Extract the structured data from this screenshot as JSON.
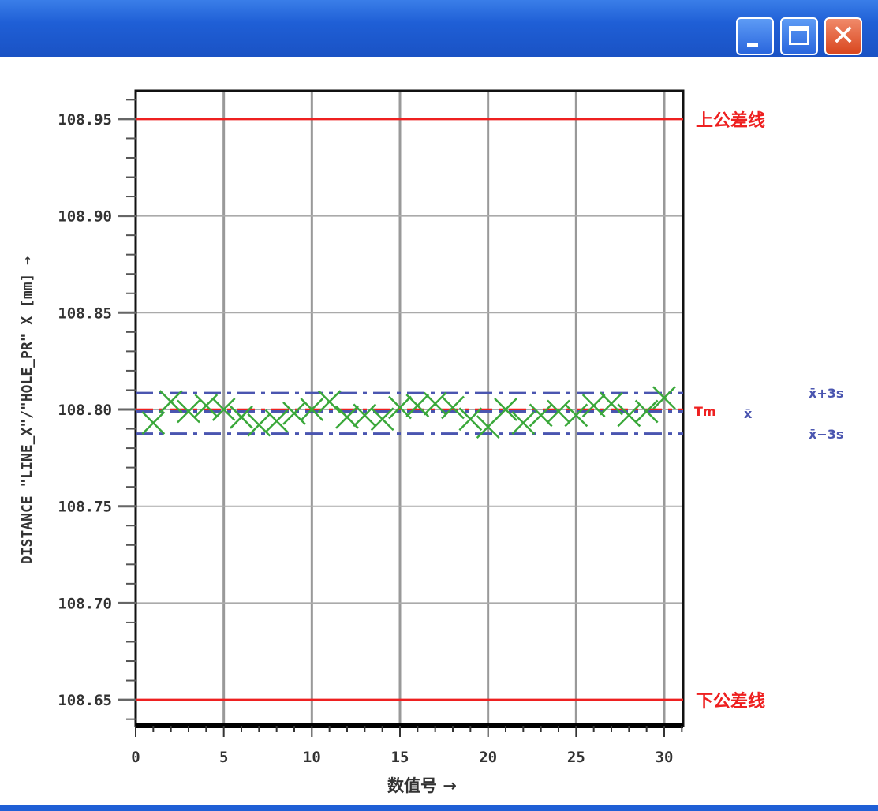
{
  "window": {
    "buttons": [
      "minimize",
      "maximize",
      "close"
    ]
  },
  "chart_data": {
    "type": "scatter",
    "xlabel": "数值号 →",
    "ylabel": "DISTANCE \"LINE_X\"/\"HOLE_PR\" X [mm] →",
    "xlim": [
      0,
      31
    ],
    "ylim": [
      108.636,
      108.964
    ],
    "xticks": [
      0,
      5,
      10,
      15,
      20,
      25,
      30
    ],
    "yticks": [
      108.65,
      108.7,
      108.75,
      108.8,
      108.85,
      108.9,
      108.95
    ],
    "ytick_labels": [
      "108.65",
      "108.70",
      "108.75",
      "108.80",
      "108.85",
      "108.90",
      "108.95"
    ],
    "grid": true,
    "x": [
      1,
      2,
      3,
      4,
      5,
      6,
      7,
      8,
      9,
      10,
      11,
      12,
      13,
      14,
      15,
      16,
      17,
      18,
      19,
      20,
      21,
      22,
      23,
      24,
      25,
      26,
      27,
      28,
      29,
      30
    ],
    "y": [
      108.793,
      108.804,
      108.799,
      108.802,
      108.8,
      108.796,
      108.792,
      108.794,
      108.798,
      108.8,
      108.804,
      108.796,
      108.797,
      108.795,
      108.801,
      108.802,
      108.803,
      108.801,
      108.795,
      108.791,
      108.8,
      108.793,
      108.797,
      108.799,
      108.797,
      108.802,
      108.803,
      108.797,
      108.799,
      108.806
    ],
    "reference_lines": [
      {
        "name": "upper_tol",
        "value": 108.95,
        "label": "上公差线",
        "color": "#ee2020",
        "style": "solid"
      },
      {
        "name": "lower_tol",
        "value": 108.65,
        "label": "下公差线",
        "color": "#ee2020",
        "style": "solid"
      },
      {
        "name": "tm",
        "value": 108.7995,
        "label": "Tm",
        "color": "#ee2020",
        "style": "dashdot"
      },
      {
        "name": "mean",
        "value": 108.799,
        "label": "x̄",
        "color": "#4a55b0",
        "style": "dashdot"
      },
      {
        "name": "mean_plus_3s",
        "value": 108.8085,
        "label": "x̄+3s",
        "color": "#4a55b0",
        "style": "dashdot"
      },
      {
        "name": "mean_minus_3s",
        "value": 108.7875,
        "label": "x̄−3s",
        "color": "#4a55b0",
        "style": "dashdot"
      }
    ],
    "marker_color": "#3aa83a"
  }
}
